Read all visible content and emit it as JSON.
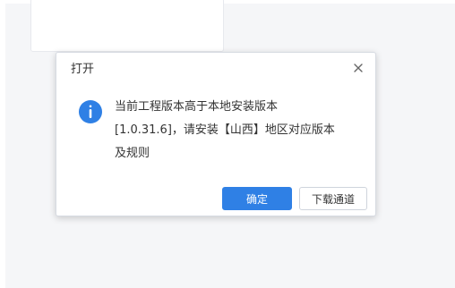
{
  "dialog": {
    "title": "打开",
    "close_icon": "close-icon",
    "info_icon": "info-icon",
    "message_lines": [
      "当前工程版本高于本地安装版本",
      "[1.0.31.6]，请安装【山西】地区对应版本",
      "及规则"
    ],
    "confirm_label": "确定",
    "download_label": "下载通道"
  },
  "colors": {
    "page_background": "#f5f6f8",
    "dialog_background": "#ffffff",
    "primary_button": "#2f80e5",
    "info_icon": "#2f80e5",
    "text": "#333333"
  }
}
